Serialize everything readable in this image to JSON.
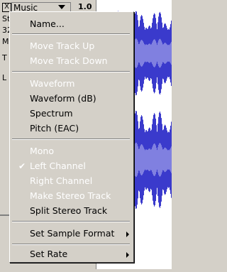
{
  "track": {
    "close_label": "X",
    "name": "Music",
    "scale": "1.0",
    "info_lines": [
      "St",
      "32",
      "M",
      "T",
      "L"
    ],
    "lower_info": [
      "L"
    ]
  },
  "menu": {
    "name": "Name...",
    "move_up": "Move Track Up",
    "move_down": "Move Track Down",
    "waveform": "Waveform",
    "waveform_db": "Waveform (dB)",
    "spectrum": "Spectrum",
    "pitch": "Pitch (EAC)",
    "mono": "Mono",
    "left_channel": "Left Channel",
    "check_mark": "✔",
    "right_channel": "Right Channel",
    "make_stereo": "Make Stereo Track",
    "split_stereo": "Split Stereo Track",
    "sample_format": "Set Sample Format",
    "set_rate": "Set Rate"
  },
  "colors": {
    "wave": "#3a3acc",
    "wave_light": "#8080e0",
    "menu_bg": "#d4d0c8"
  }
}
